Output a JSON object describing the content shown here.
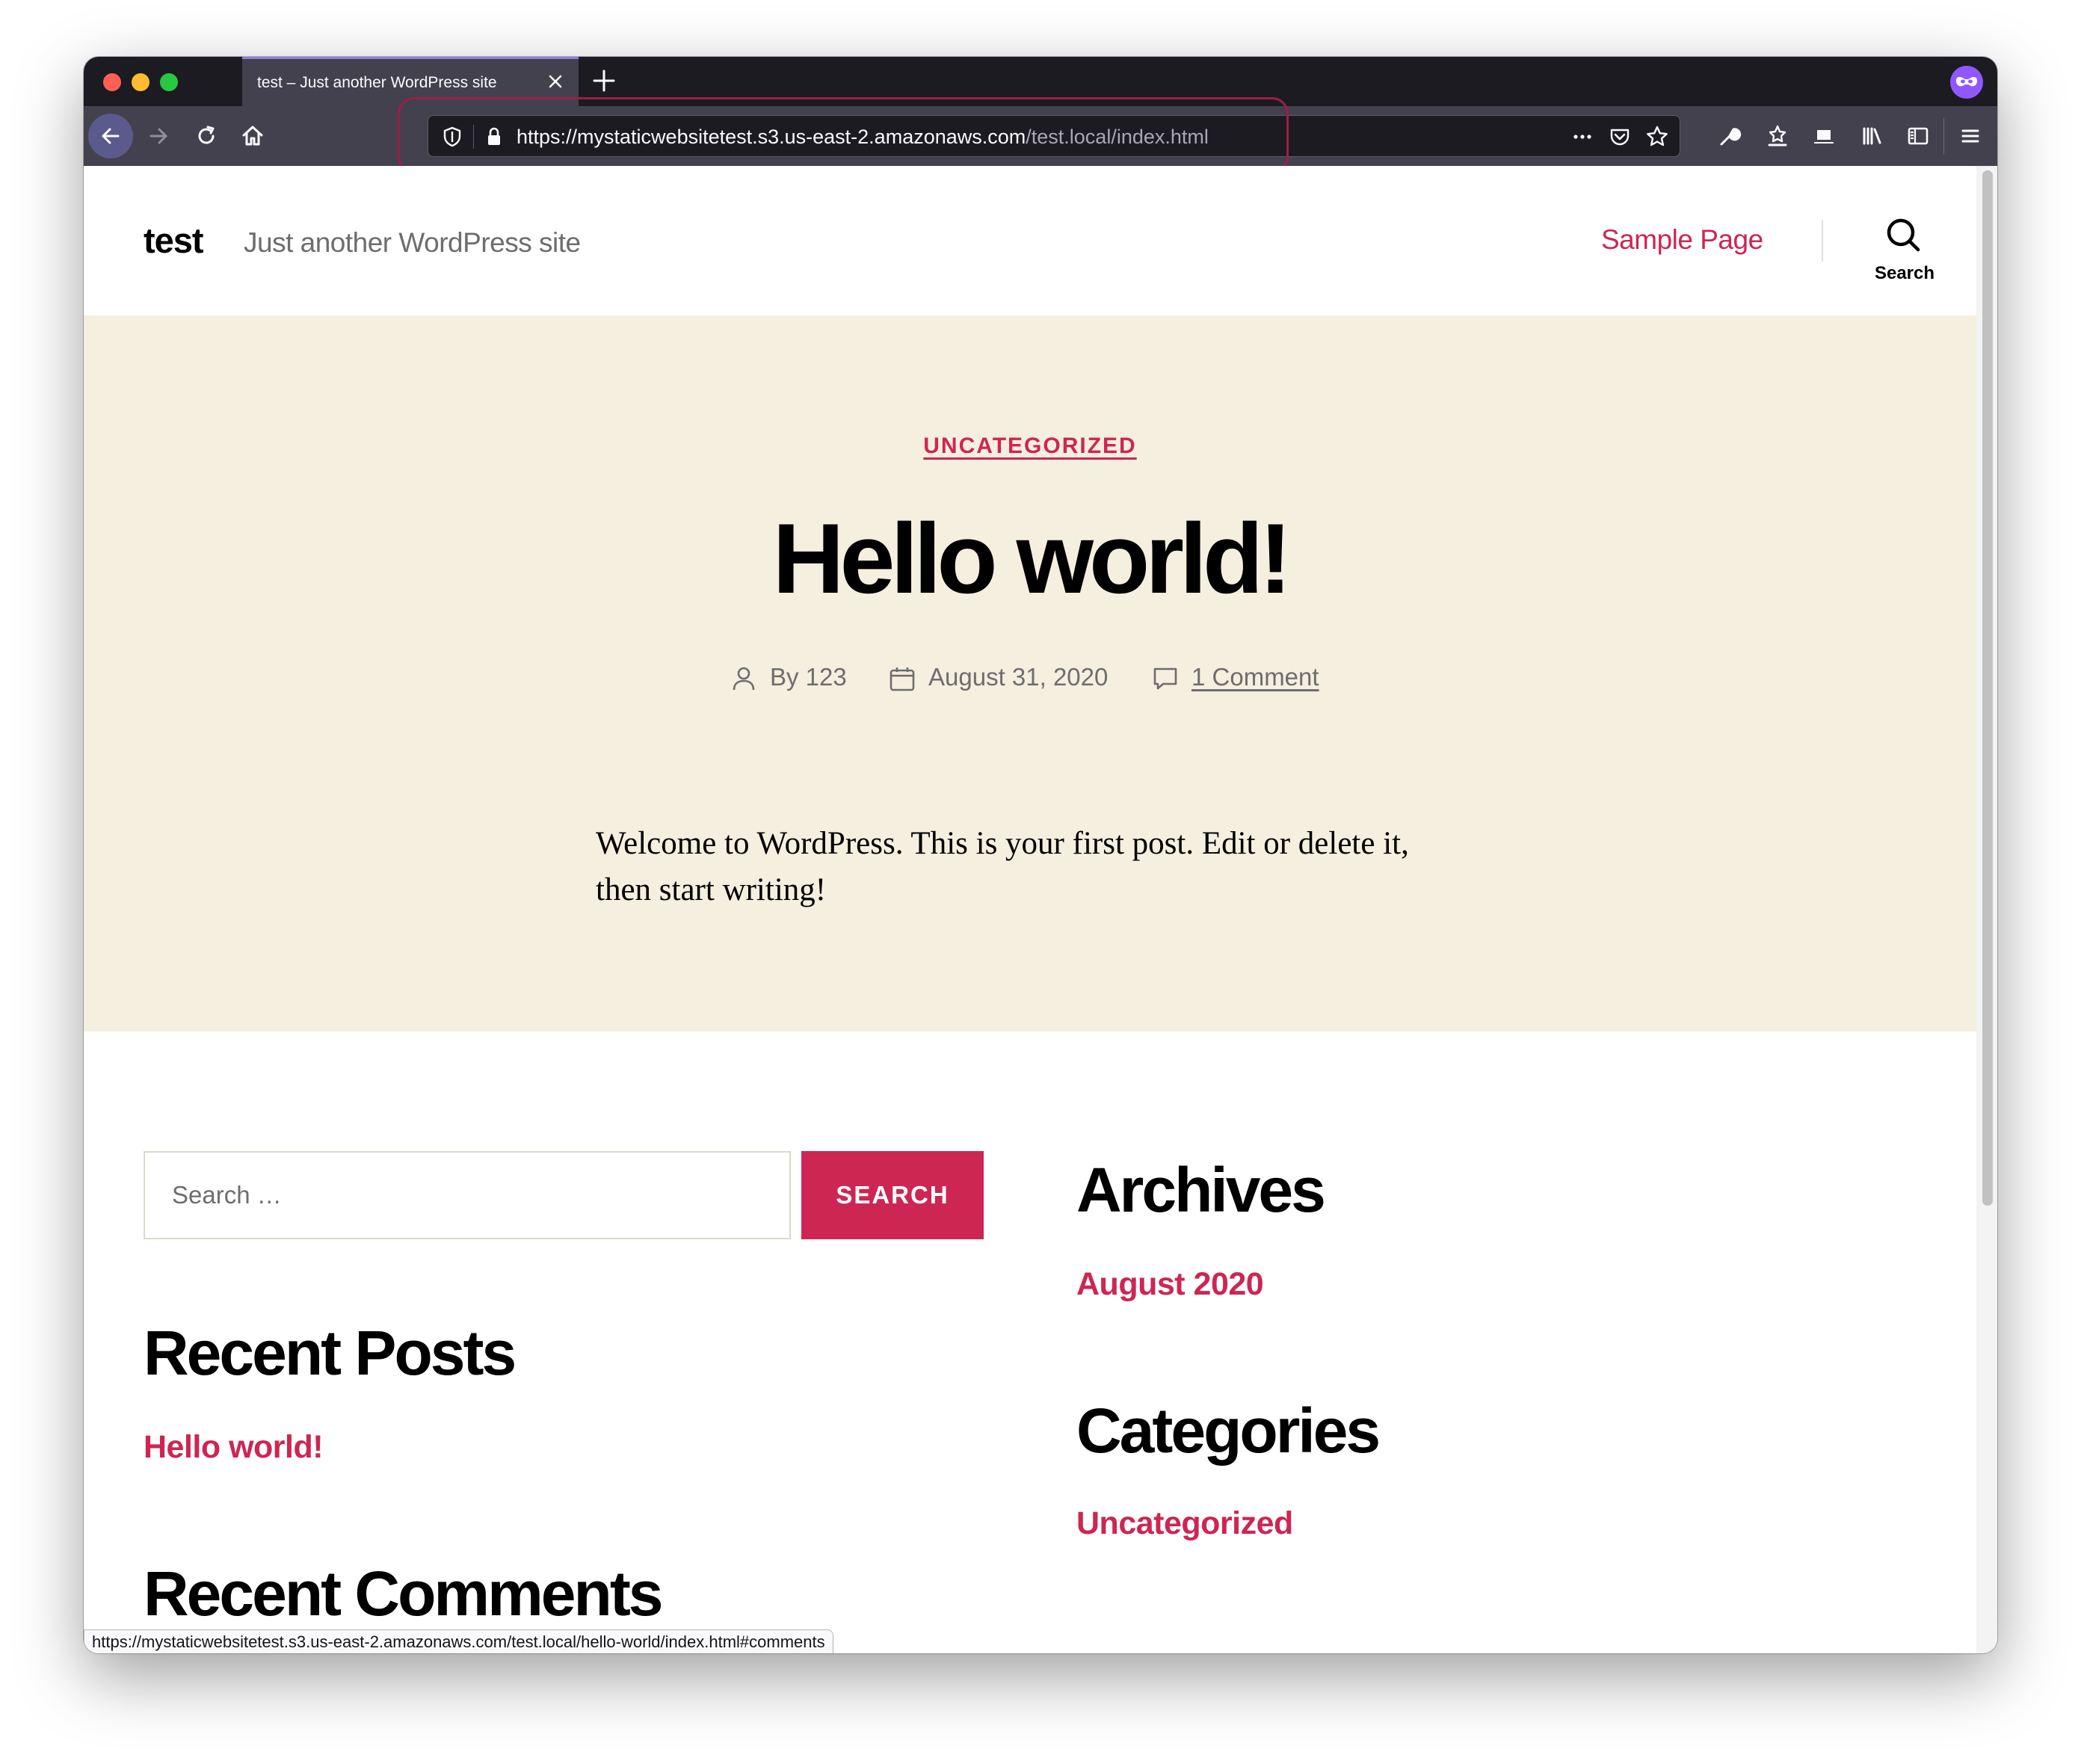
{
  "browser": {
    "tab_title": "test – Just another WordPress site",
    "url_host": "https://mystaticwebsitetest.s3.us-east-2.amazonaws.com",
    "url_path": "/test.local/index.html",
    "status_url": "https://mystaticwebsitetest.s3.us-east-2.amazonaws.com/test.local/hello-world/index.html#comments"
  },
  "site": {
    "title": "test",
    "description": "Just another WordPress site",
    "menu_item": "Sample Page",
    "search_toggle_label": "Search"
  },
  "post": {
    "category": "UNCATEGORIZED",
    "title": "Hello world!",
    "author": "By 123",
    "date": "August 31, 2020",
    "comments": "1 Comment",
    "content": "Welcome to WordPress. This is your first post. Edit or delete it, then start writing!"
  },
  "widgets": {
    "search_placeholder": "Search …",
    "search_button": "SEARCH",
    "recent_posts_title": "Recent Posts",
    "recent_post": "Hello world!",
    "recent_comments_title": "Recent Comments",
    "archives_title": "Archives",
    "archive_item": "August 2020",
    "categories_title": "Categories",
    "category_item": "Uncategorized"
  },
  "colors": {
    "accent": "#cd2653",
    "hero_background": "#f5efe0",
    "browser_chrome": "#42414d",
    "private_badge": "#9059ff"
  }
}
